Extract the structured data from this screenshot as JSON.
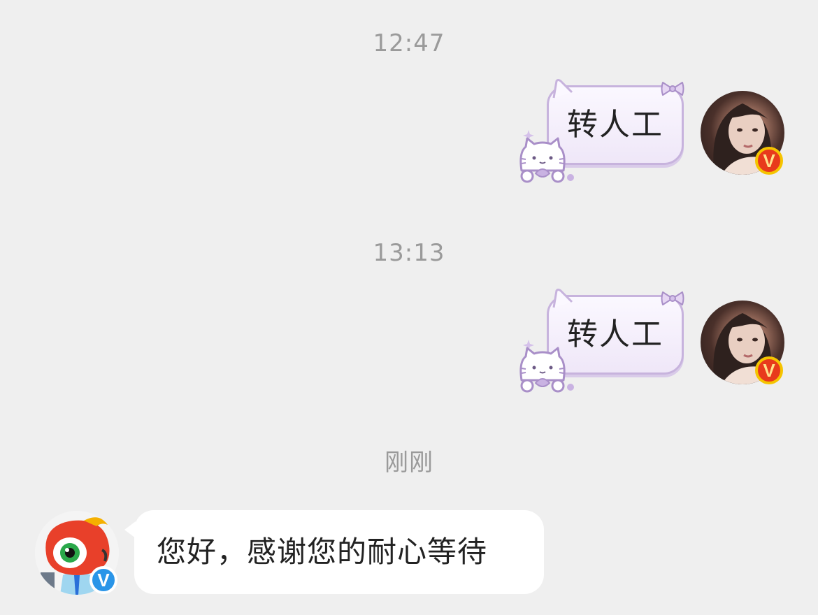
{
  "timestamps": [
    "12:47",
    "13:13",
    "刚刚"
  ],
  "messages": [
    {
      "side": "right",
      "text": "转人工",
      "style": "kitty-bubble",
      "avatar": "user-photo-avatar",
      "badge": "V",
      "badge_color": "#e83a1c"
    },
    {
      "side": "right",
      "text": "转人工",
      "style": "kitty-bubble",
      "avatar": "user-photo-avatar",
      "badge": "V",
      "badge_color": "#e83a1c"
    },
    {
      "side": "left",
      "text": "您好，感谢您的耐心等待",
      "style": "white-bubble",
      "avatar": "weibo-mascot-avatar",
      "badge": "V",
      "badge_color": "#2a95e8"
    }
  ],
  "colors": {
    "background": "#efefef",
    "timestamp": "#9a9a9a",
    "bubble_border": "#c7b3dd",
    "bubble_fill": "#f3edf9"
  }
}
